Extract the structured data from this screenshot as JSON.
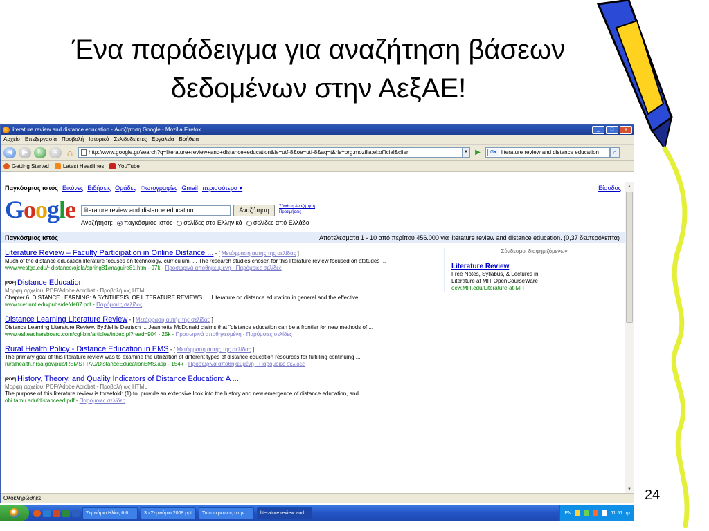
{
  "slide": {
    "title_line1": "Ένα παράδειγμα για αναζήτηση βάσεων",
    "title_line2": "δεδομένων στην ΑεξΑΕ!",
    "page_number": "24"
  },
  "window": {
    "title": "literature review and distance education - Αναζήτηση Google - Mozilla Firefox",
    "controls": [
      "_",
      "□",
      "x"
    ]
  },
  "menu": [
    "Αρχείο",
    "Επεξεργασία",
    "Προβολή",
    "Ιστορικό",
    "Σελιδοδείκτες",
    "Εργαλεία",
    "Βοήθεια"
  ],
  "nav": {
    "url": "http://www.google.gr/search?q=literature+review+and+distance+education&ie=utf-8&oe=utf-8&aq=t&rls=org.mozilla:el:official&clier",
    "search_value": "literature review and distance education"
  },
  "bookmarks": [
    "Getting Started",
    "Latest Headlines",
    "YouTube"
  ],
  "google": {
    "gbar": [
      "Παγκόσμιος ιστός",
      "Εικόνες",
      "Ειδήσεις",
      "Ομάδες",
      "Φωτογραφίες",
      "Gmail",
      "περισσότερα ▾"
    ],
    "signin": "Είσοδος",
    "logo": [
      "G",
      "o",
      "o",
      "g",
      "l",
      "e"
    ],
    "query": "literature review and distance education",
    "search_button": "Αναζήτηση",
    "advanced": "Σύνθετη Αναζήτηση",
    "prefs": "Προτιμήσεις",
    "search_in_label": "Αναζήτηση:",
    "search_in_options": [
      "παγκόσμιος ιστός",
      "σελίδες στα Ελληνικά",
      "σελίδες από Ελλάδα"
    ],
    "results_label": "Παγκόσμιος ιστός",
    "results_stats": "Αποτελέσματα 1 - 10 από περίπου 456.000 για literature review and distance education. (0,37 δευτερόλεπτα)"
  },
  "results": [
    {
      "title": "Literature Review – Faculty Participation in Online Distance ...",
      "translate": "Μετάφραση αυτής της σελίδας",
      "pdf": false,
      "meta": "",
      "snippet": "Much of the distance education literature focuses on technology, curriculum, ... The research studies chosen for this literature review focused on attitudes ...",
      "url": "www.westga.edu/~distance/ojdla/spring81/maguire81.htm - 97k -",
      "cache": "Προσωρινά αποθηκευμένη - Παρόμοιες σελίδες"
    },
    {
      "title": "Distance Education",
      "translate": "",
      "pdf": true,
      "meta": "Μορφή αρχείου: PDF/Adobe Acrobat - Προβολή ως HTML",
      "snippet": "Chapter 6. DISTANCE LEARNING: A SYNTHESIS. OF LITERATURE REVIEWS .... Literature on distance education in general and the effective ...",
      "url": "www.tcet.unt.edu/pubs/de/de07.pdf -",
      "cache": "Παρόμοιες σελίδες"
    },
    {
      "title": "Distance Learning Literature Review",
      "translate": "Μετάφραση αυτής της σελίδας",
      "pdf": false,
      "meta": "",
      "snippet": "Distance Learning Literature Review. By:Nellie Deutsch ... Jeannette McDonald claims that \"distance education can be a frontier for new methods of ...",
      "url": "www.eslteachersboard.com/cgi-bin/articles/index.pl?read=904 - 25k -",
      "cache": "Προσωρινά αποθηκευμένη - Παρόμοιες σελίδες"
    },
    {
      "title": "Rural Health Policy - Distance Education in EMS",
      "translate": "Μετάφραση αυτής της σελίδας",
      "pdf": false,
      "meta": "",
      "snippet": "The primary goal of this literature review was to examine the utilization of different types of distance education resources for fulfilling continuing ...",
      "url": "ruralhealth.hrsa.gov/pub/REMSTTAC/DistanceEducationEMS.asp - 154k -",
      "cache": "Προσωρινά αποθηκευμένη - Παρόμοιες σελίδες"
    },
    {
      "title": "History, Theory, and Quality Indicators of Distance Education: A ...",
      "translate": "",
      "pdf": true,
      "meta": "Μορφή αρχείου: PDF/Adobe Acrobat - Προβολή ως HTML",
      "snippet": "The purpose of this literature review is threefold: (1) to. provide an extensive look into the history and new emergence of distance education, and ...",
      "url": "ohi.tamu.edu/distanceed.pdf -",
      "cache": "Παρόμοιες σελίδες"
    }
  ],
  "sponsored": {
    "header": "Σύνδεσμοι διαφημιζόμενων",
    "title": "Literature Review",
    "line1": "Free Notes, Syllabus, & Lectures in",
    "line2": "Literature at MIT OpenCourseWare",
    "url": "ocw.MIT.edu/Literature-at-MIT"
  },
  "status": "Ολοκληρώθηκε",
  "taskbar": {
    "tasks": [
      "Σεμινάριο Ηλίας 6.6....",
      "3ο Σεμινάριο 2008.ppt",
      "Τύποι έρευνας στην...",
      "literature review and..."
    ],
    "lang": "EN",
    "clock": "11:51 πμ"
  }
}
